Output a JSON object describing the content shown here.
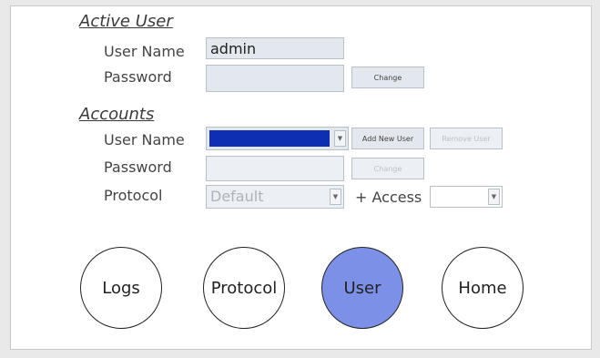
{
  "active_user": {
    "section_title": "Active User",
    "username_label": "User Name",
    "username_value": "admin",
    "password_label": "Password",
    "change_button": "Change"
  },
  "accounts": {
    "section_title": "Accounts",
    "username_label": "User Name",
    "password_label": "Password",
    "protocol_label": "Protocol",
    "protocol_value": "Default",
    "access_label": "+ Access",
    "add_button": "Add New User",
    "remove_button": "Remove User",
    "change_button": "Change"
  },
  "nav": {
    "logs": "Logs",
    "protocol": "Protocol",
    "user": "User",
    "home": "Home",
    "active": "User"
  },
  "colors": {
    "selected_user_fill": "#0e2fb2",
    "active_nav": "#7c90e8"
  }
}
